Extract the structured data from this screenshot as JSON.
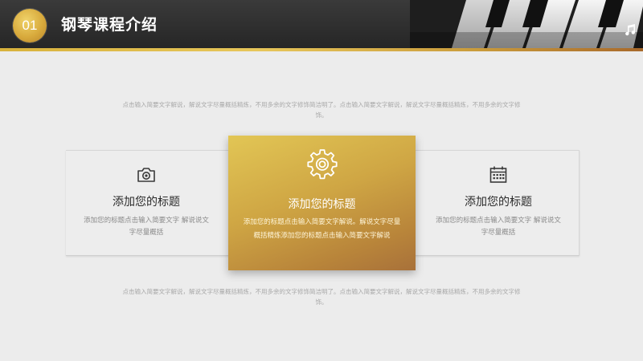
{
  "header": {
    "number": "01",
    "title": "钢琴课程介绍",
    "note_icon": "music-note-icon"
  },
  "intro_text": "点击输入简要文字解说，解说文字尽量概括精炼，不用多余的文字修饰简洁明了。点击输入简要文字解说，解说文字尽量概括精炼，不用多余的文字修饰。",
  "footer_text": "点击输入简要文字解说，解说文字尽量概括精炼，不用多余的文字修饰简洁明了。点击输入简要文字解说，解说文字尽量概括精炼，不用多余的文字修饰。",
  "cards": {
    "left": {
      "icon": "camera-icon",
      "title": "添加您的标题",
      "body": "添加您的标题点击输入简要文字 解说说文字尽量概括"
    },
    "center": {
      "icon": "gear-icon",
      "title": "添加您的标题",
      "body": "添加您的标题点击输入简要文字解说。解说文字尽量概括精炼添加您的标题点击输入简要文字解说"
    },
    "right": {
      "icon": "calendar-icon",
      "title": "添加您的标题",
      "body": "添加您的标题点击输入简要文字 解说说文字尽量概括"
    }
  },
  "colors": {
    "gold_light": "#e2c655",
    "gold_dark": "#a8713a",
    "header_bg": "#2b2b2b",
    "page_bg": "#ececec"
  }
}
